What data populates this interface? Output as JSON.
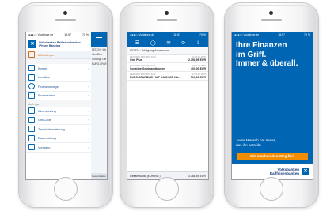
{
  "status": {
    "carrier": "●●●○○ Vodafone.de",
    "time": "18:57",
    "battery": "70 %"
  },
  "menu": {
    "brand_line1": "Volksbanken Raiffeisenbanken",
    "brand_line2": "iPhone Banking",
    "messages": "Mitteilungen",
    "items": [
      {
        "label": "Konten"
      },
      {
        "label": "Umsätze"
      },
      {
        "label": "Finanzmanager"
      },
      {
        "label": "Finanzstatus"
      }
    ],
    "section_orders": "Aufträge",
    "orders": [
      {
        "label": "Überweisung"
      },
      {
        "label": "GiroCode"
      },
      {
        "label": "Terminüberweisung"
      },
      {
        "label": "Dauerauftrag"
      },
      {
        "label": "Vorlagen"
      }
    ],
    "peek_lines": [
      "057324 · Wo",
      "Giro Plus",
      "Sonstige Gel",
      "EURO-SPARB"
    ],
    "peek_footer": "Gesamtsaldo"
  },
  "accounts": {
    "header": "057324 · Wolfgang Ackermann",
    "rows": [
      {
        "iban": "DE74 0000 0000 0057 3240",
        "date": "17.04.15 18:57",
        "name": "Giro Plus",
        "amount": "2.391,95 EUR"
      },
      {
        "iban": "DE12 0000 0000 0057 3241",
        "date": "17.04.15 18:57",
        "name": "Sonstige Geldmarktkonten",
        "amount": "400,00 EUR"
      },
      {
        "iban": "DE33 0000 0000 0057 3242",
        "date": "17.04.15 18:57",
        "name": "EURO-SPARBUCH MIT 3-MONAT. KU…",
        "amount": "500,00 EUR"
      }
    ],
    "total_label": "Gesamtsaldo (EUR Kto.)",
    "total_value": "3.386,59 EUR"
  },
  "ad": {
    "headline_1": "Ihre Finanzen",
    "headline_2": "im Griff.",
    "headline_3": "Immer & überall.",
    "sub_1": "Jeder Mensch hat etwas,",
    "sub_2": "das ihn antreibt.",
    "cta": "Wir machen den Weg frei.",
    "bank_1": "Volksbanken",
    "bank_2": "Raiffeisenbanken"
  },
  "colors": {
    "brand_blue": "#0066b3",
    "accent_orange": "#f28c00"
  }
}
